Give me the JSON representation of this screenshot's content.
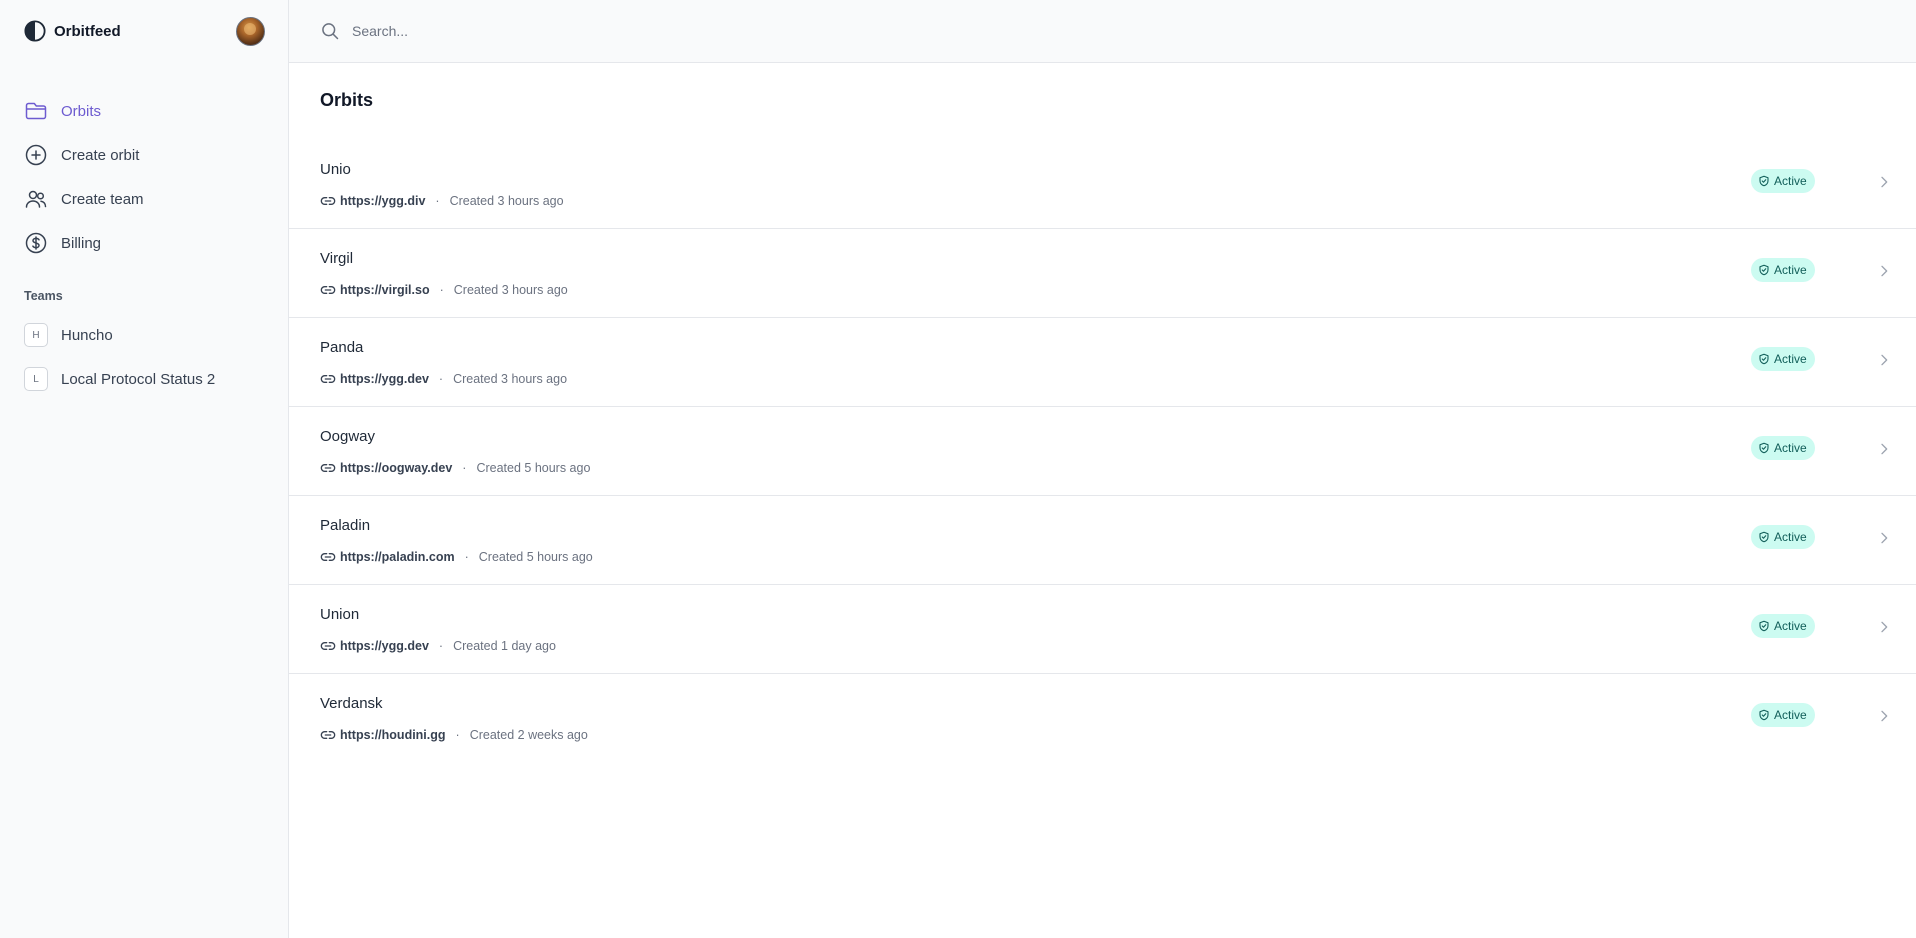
{
  "brand": {
    "name": "Orbitfeed"
  },
  "search": {
    "placeholder": "Search..."
  },
  "nav": [
    {
      "label": "Orbits",
      "icon": "folder-icon",
      "active": true
    },
    {
      "label": "Create orbit",
      "icon": "plus-circle-icon",
      "active": false
    },
    {
      "label": "Create team",
      "icon": "users-icon",
      "active": false
    },
    {
      "label": "Billing",
      "icon": "dollar-circle-icon",
      "active": false
    }
  ],
  "teams": {
    "heading": "Teams",
    "items": [
      {
        "initial": "H",
        "name": "Huncho"
      },
      {
        "initial": "L",
        "name": "Local Protocol Status 2"
      }
    ]
  },
  "page": {
    "title": "Orbits"
  },
  "orbits": [
    {
      "name": "Unio",
      "url": "https://ygg.div",
      "separator": "·",
      "created": "Created 3 hours ago",
      "status": "Active"
    },
    {
      "name": "Virgil",
      "url": "https://virgil.so",
      "separator": "·",
      "created": "Created 3 hours ago",
      "status": "Active"
    },
    {
      "name": "Panda",
      "url": "https://ygg.dev",
      "separator": "·",
      "created": "Created 3 hours ago",
      "status": "Active"
    },
    {
      "name": "Oogway",
      "url": "https://oogway.dev",
      "separator": "·",
      "created": "Created 5 hours ago",
      "status": "Active"
    },
    {
      "name": "Paladin",
      "url": "https://paladin.com",
      "separator": "·",
      "created": "Created 5 hours ago",
      "status": "Active"
    },
    {
      "name": "Union",
      "url": "https://ygg.dev",
      "separator": "·",
      "created": "Created 1 day ago",
      "status": "Active"
    },
    {
      "name": "Verdansk",
      "url": "https://houdini.gg",
      "separator": "·",
      "created": "Created 2 weeks ago",
      "status": "Active"
    }
  ],
  "colors": {
    "accent": "#6d5bd0",
    "status_bg": "#ccfbf1",
    "status_text": "#115e59",
    "sidebar_bg": "#f9fafb",
    "border": "#e5e7eb"
  }
}
